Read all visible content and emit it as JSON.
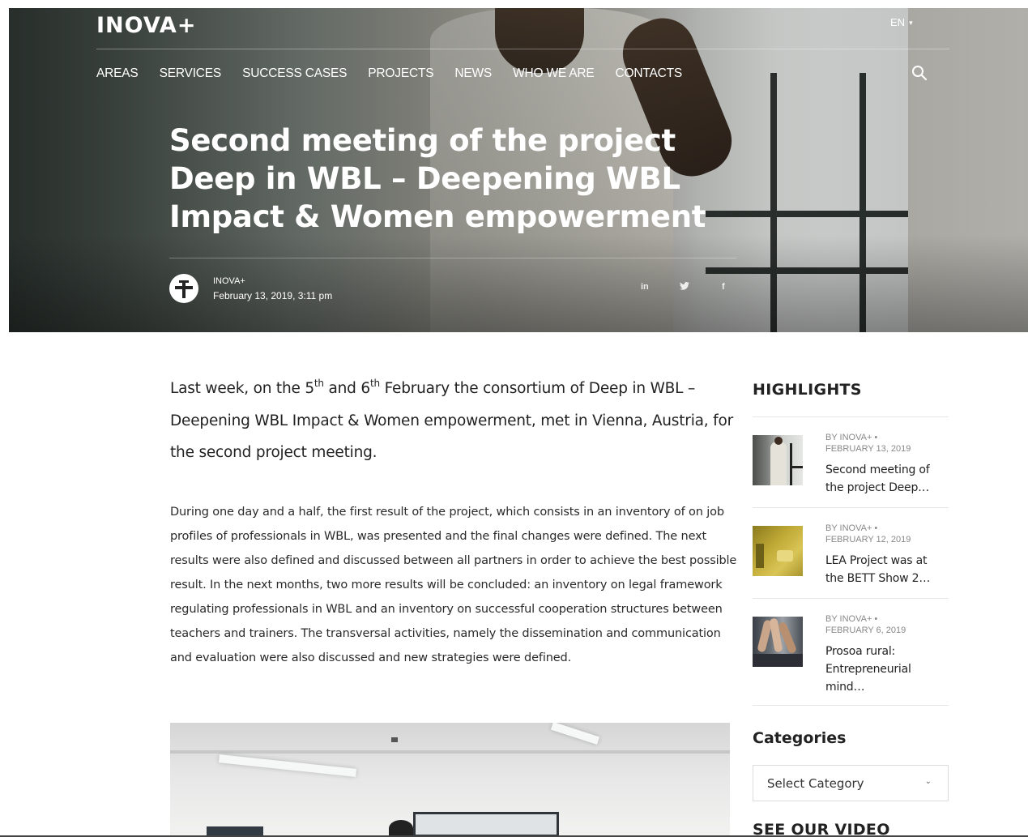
{
  "header": {
    "logo": "INOVA+",
    "language": "EN",
    "nav": [
      "AREAS",
      "SERVICES",
      "SUCCESS CASES",
      "PROJECTS",
      "NEWS",
      "WHO WE ARE",
      "CONTACTS"
    ]
  },
  "hero": {
    "title": "Second meeting of the project Deep in WBL – Deepening WBL Impact & Women empowerment",
    "author": "INOVA+",
    "date": "February 13, 2019, 3:11 pm",
    "share": [
      "in",
      "twitter-icon",
      "f"
    ]
  },
  "article": {
    "lead_part1": "Last week, on the 5",
    "lead_sup1": "th",
    "lead_part2": " and 6",
    "lead_sup2": "th",
    "lead_part3": " February the consortium of Deep in WBL – Deepening WBL Impact & Women empowerment, met in Vienna, Austria, for the second project meeting.",
    "body": "During one day and a half, the first result of the project, which consists in an inventory of on job profiles of professionals in WBL, was presented and the final changes were defined. The next results were also defined and discussed between all partners in order to achieve the best possible result. In the next months, two more results will be concluded: an inventory on legal framework regulating professionals in WBL and an inventory on successful cooperation structures between teachers and trainers. The transversal activities, namely the dissemination and communication and evaluation were also discussed and new strategies were defined."
  },
  "sidebar": {
    "highlights_heading": "HIGHLIGHTS",
    "highlights": [
      {
        "meta1": "BY INOVA+ •",
        "meta2": "FEBRUARY 13, 2019",
        "title": "Second meeting of the project Deep…"
      },
      {
        "meta1": "BY INOVA+ •",
        "meta2": "FEBRUARY 12, 2019",
        "title": "LEA Project was at the BETT Show 2…"
      },
      {
        "meta1": "BY INOVA+ •",
        "meta2": "FEBRUARY 6, 2019",
        "title": "Prosoa rural: Entrepreneurial mind…"
      }
    ],
    "categories_heading": "Categories",
    "category_select": "Select Category",
    "video_heading": "SEE OUR VIDEO"
  }
}
